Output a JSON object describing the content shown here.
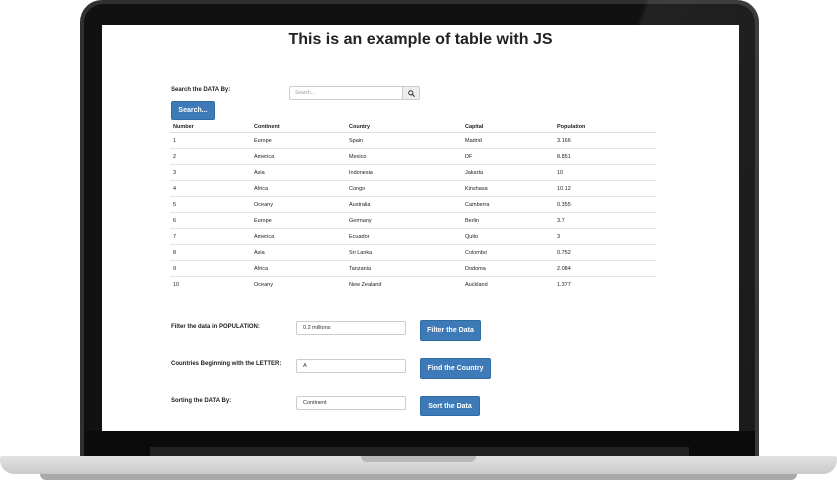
{
  "page": {
    "title": "This is an example of table with JS"
  },
  "search": {
    "label": "Search the DATA By:",
    "placeholder": "Search...",
    "button_label": "Search..."
  },
  "table": {
    "columns": [
      "Number",
      "Continent",
      "Country",
      "Capital",
      "Population"
    ],
    "rows": [
      [
        "1",
        "Europe",
        "Spain",
        "Madrid",
        "3.166"
      ],
      [
        "2",
        "America",
        "Mexico",
        "DF",
        "8.851"
      ],
      [
        "3",
        "Asia",
        "Indonesia",
        "Jakarta",
        "10"
      ],
      [
        "4",
        "Africa",
        "Congo",
        "Kinshasa",
        "10.12"
      ],
      [
        "5",
        "Oceany",
        "Australia",
        "Camberra",
        "0.355"
      ],
      [
        "6",
        "Europe",
        "Germany",
        "Berlin",
        "3.7"
      ],
      [
        "7",
        "America",
        "Ecuador",
        "Quito",
        "3"
      ],
      [
        "8",
        "Asia",
        "Sri Lanka",
        "Colombo",
        "0.752"
      ],
      [
        "9",
        "Africa",
        "Tanzania",
        "Dodoma",
        "2.084"
      ],
      [
        "10",
        "Oceany",
        "New Zealand",
        "Auckland",
        "1.377"
      ]
    ]
  },
  "filter": {
    "label": "Filter the data in POPULATION:",
    "value": "0.2 millions",
    "button_label": "Filter the Data"
  },
  "letter": {
    "label": "Countries Beginning with the LETTER:",
    "value": "A",
    "button_label": "Find the Country"
  },
  "sort": {
    "label": "Sorting the DATA By:",
    "value": "Continent",
    "button_label": "Sort the Data"
  },
  "colors": {
    "button_primary": "#3e7ab8",
    "laptop_body": "#2f3031",
    "laptop_base": "#d6d6d6"
  },
  "icons": {
    "search_button_icon": "magnifier-icon"
  }
}
